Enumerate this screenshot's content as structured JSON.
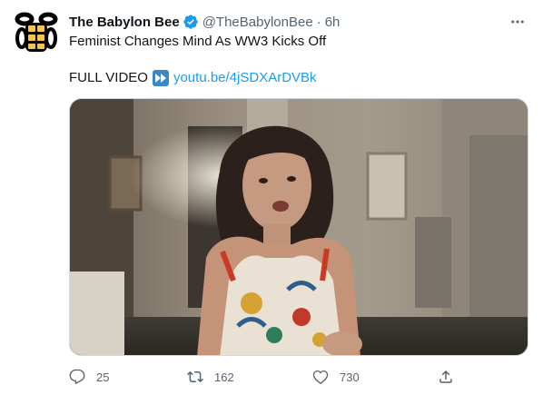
{
  "tweet": {
    "display_name": "The Babylon Bee",
    "handle": "@TheBabylonBee",
    "separator": "·",
    "time": "6h",
    "headline": "Feminist Changes Mind As WW3 Kicks Off",
    "full_video_label": "FULL VIDEO",
    "link_text": "youtu.be/4jSDXArDVBk",
    "avatar_icon": "bee-logo-icon",
    "more_icon": "more-options-icon",
    "media": {
      "type": "video-thumbnail"
    }
  },
  "actions": {
    "replies": "25",
    "retweets": "162",
    "likes": "730"
  },
  "colors": {
    "accent": "#1d9bf0",
    "secondary_text": "#536471",
    "primary_text": "#0f1419"
  }
}
